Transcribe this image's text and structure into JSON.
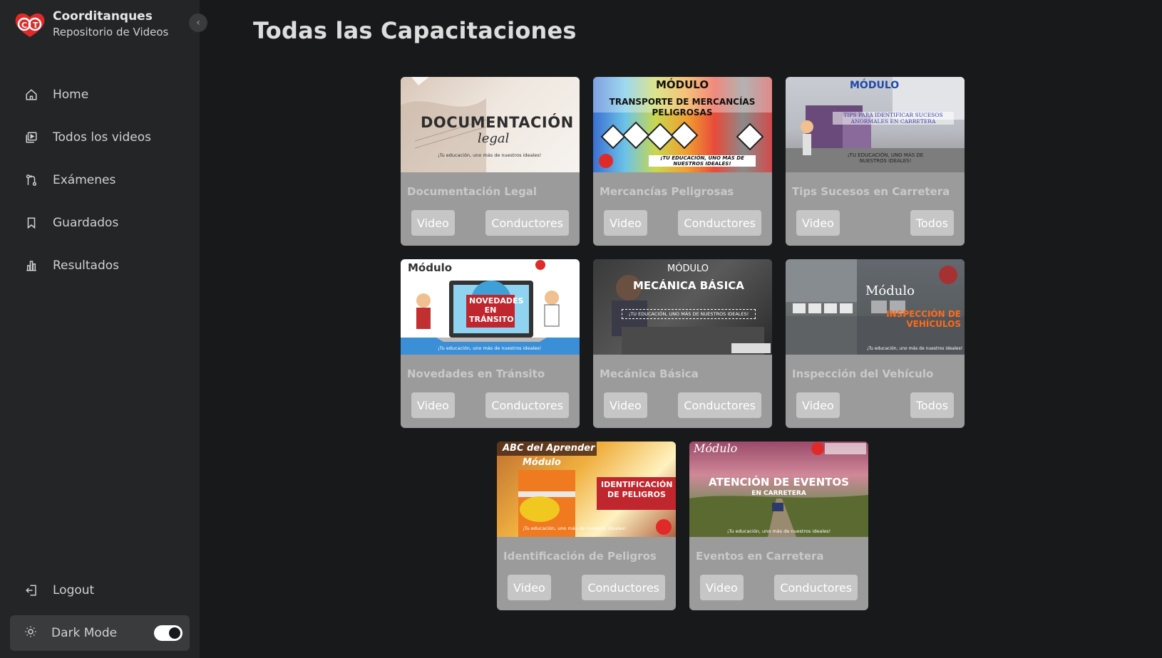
{
  "brand": {
    "name": "Coorditanques",
    "subtitle": "Repositorio de Videos",
    "logo_text": "CT"
  },
  "nav": [
    {
      "label": "Home",
      "icon": "home-icon"
    },
    {
      "label": "Todos los videos",
      "icon": "video-library-icon"
    },
    {
      "label": "Exámenes",
      "icon": "exam-icon"
    },
    {
      "label": "Guardados",
      "icon": "bookmark-icon"
    },
    {
      "label": "Resultados",
      "icon": "bar-chart-icon"
    }
  ],
  "logout": {
    "label": "Logout",
    "icon": "logout-icon"
  },
  "darkmode": {
    "label": "Dark Mode",
    "icon": "sun-icon",
    "enabled": true
  },
  "page": {
    "title": "Todas las Capacitaciones"
  },
  "cards": [
    {
      "title": "Documentación Legal",
      "video": "Video",
      "audience": "Conductores",
      "thumb": {
        "headline": "DOCUMENTACIÓN",
        "sub": "legal",
        "tagline": "¡Tu educación, uno más de nuestros ideales!"
      }
    },
    {
      "title": "Mercancías Peligrosas",
      "video": "Video",
      "audience": "Conductores",
      "thumb": {
        "headline": "MÓDULO",
        "sub": "TRANSPORTE DE MERCANCÍAS PELIGROSAS",
        "tagline": "¡TU EDUCACIÓN, UNO MÁS DE NUESTROS IDEALES!"
      }
    },
    {
      "title": "Tips Sucesos en Carretera",
      "video": "Video",
      "audience": "Todos",
      "thumb": {
        "headline": "MÓDULO",
        "sub": "TIPS PARA IDENTIFICAR SUCESOS ANORMALES EN CARRETERA",
        "tagline": "¡TU EDUCACIÓN, UNO MÁS DE NUESTROS IDEALES!"
      }
    },
    {
      "title": "Novedades en Tránsito",
      "video": "Video",
      "audience": "Conductores",
      "thumb": {
        "headline": "Módulo",
        "sub": "NOVEDADES EN TRÁNSITO",
        "tagline": "¡Tu educación, uno más de nuestros ideales!"
      }
    },
    {
      "title": "Mecánica Básica",
      "video": "Video",
      "audience": "Conductores",
      "thumb": {
        "headline": "MÓDULO",
        "sub": "MECÁNICA BÁSICA",
        "tagline": "¡TU EDUCACIÓN, UNO MÁS DE NUESTROS IDEALES!"
      }
    },
    {
      "title": "Inspección del Vehículo",
      "video": "Video",
      "audience": "Todos",
      "thumb": {
        "headline": "Módulo",
        "sub": "INSPECCIÓN DE VEHÍCULOS",
        "tagline": "¡Tu educación, uno más de nuestros ideales!"
      }
    },
    {
      "title": "Identificación de Peligros",
      "video": "Video",
      "audience": "Conductores",
      "thumb": {
        "headline": "ABC del Aprender",
        "sub": "IDENTIFICACIÓN DE PELIGROS",
        "tagline": "¡Tu educación, uno más de nuestros ideales!",
        "extra": "Módulo"
      }
    },
    {
      "title": "Eventos en Carretera",
      "video": "Video",
      "audience": "Conductores",
      "thumb": {
        "headline": "Módulo",
        "sub": "ATENCIÓN DE EVENTOS",
        "tagline": "¡Tu educación, uno más de nuestros ideales!",
        "extra": "EN CARRETERA"
      }
    }
  ],
  "colors": {
    "background": "#18191a",
    "sidebar": "#242526",
    "card": "#9b9b9b",
    "button": "#c6c6c6",
    "brand_red": "#e02a2a"
  }
}
